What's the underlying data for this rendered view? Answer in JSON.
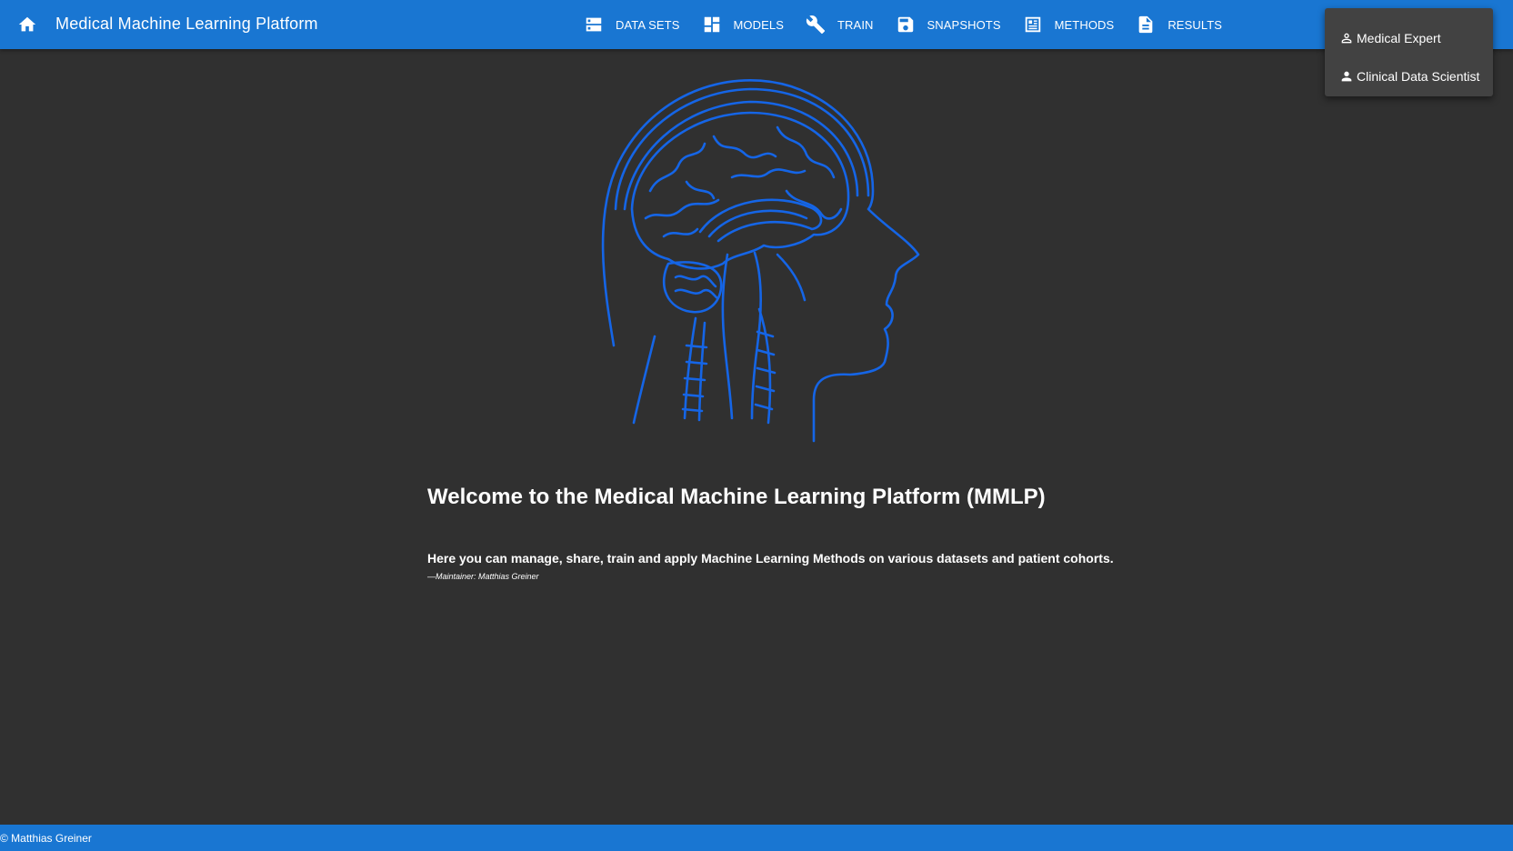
{
  "app": {
    "title": "Medical Machine Learning Platform",
    "home_icon": "home-icon"
  },
  "colors": {
    "primary": "#1976d2",
    "background": "#303030",
    "menu_background": "#424242",
    "illustration": "#1565e6"
  },
  "nav": {
    "items": [
      {
        "label": "DATA SETS",
        "icon": "storage-icon"
      },
      {
        "label": "MODELS",
        "icon": "dashboard-icon"
      },
      {
        "label": "TRAIN",
        "icon": "wrench-icon"
      },
      {
        "label": "SNAPSHOTS",
        "icon": "save-icon"
      },
      {
        "label": "METHODS",
        "icon": "article-icon"
      },
      {
        "label": "RESULTS",
        "icon": "description-icon"
      }
    ]
  },
  "user_menu": {
    "items": [
      {
        "label": "Medical Expert",
        "icon": "person-outline-icon"
      },
      {
        "label": "Clinical Data Scientist",
        "icon": "person-icon"
      }
    ]
  },
  "main": {
    "hero_image": "brain-head-illustration",
    "welcome": "Welcome to the Medical Machine Learning Platform (MMLP)",
    "intro": "Here you can manage, share, train and apply Machine Learning Methods on various datasets and patient cohorts.",
    "maintainer": "—Maintainer: Matthias Greiner"
  },
  "footer": {
    "text": "© Matthias Greiner"
  }
}
